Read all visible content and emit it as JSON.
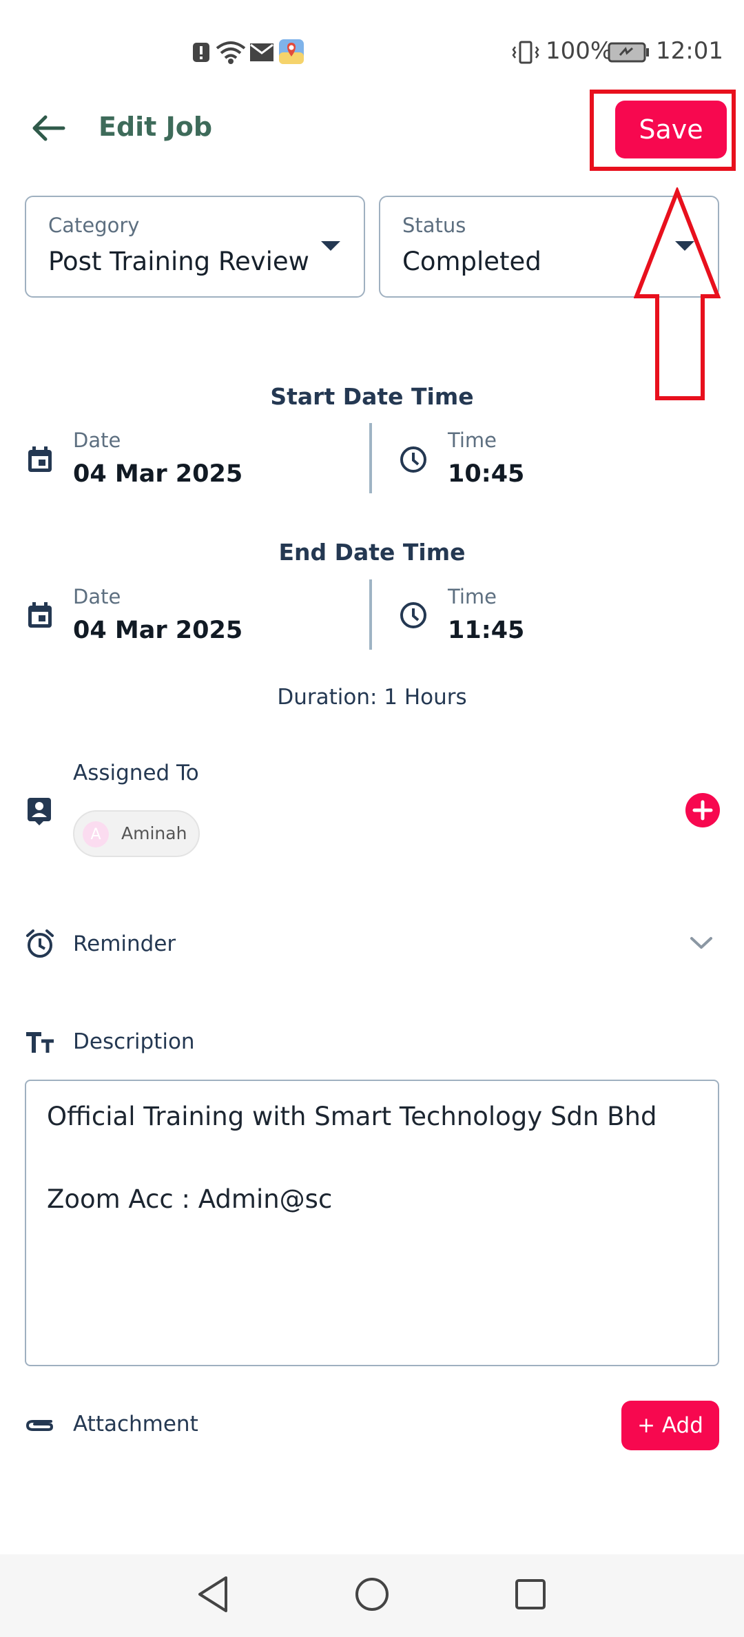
{
  "status_bar": {
    "battery": "100%",
    "time": "12:01"
  },
  "header": {
    "title": "Edit Job",
    "save_label": "Save"
  },
  "category": {
    "label": "Category",
    "value": "Post Training Review"
  },
  "status": {
    "label": "Status",
    "value": "Completed"
  },
  "start": {
    "title": "Start Date Time",
    "date_label": "Date",
    "date": "04 Mar 2025",
    "time_label": "Time",
    "time": "10:45"
  },
  "end": {
    "title": "End Date Time",
    "date_label": "Date",
    "date": "04 Mar 2025",
    "time_label": "Time",
    "time": "11:45"
  },
  "duration": "Duration: 1 Hours",
  "assigned": {
    "label": "Assigned To",
    "chip_initial": "A",
    "chip_name": "Aminah"
  },
  "reminder": {
    "label": "Reminder"
  },
  "description": {
    "label": "Description",
    "value": "Official Training with Smart Technology Sdn Bhd\n\nZoom Acc : Admin@sc"
  },
  "attachment": {
    "label": "Attachment",
    "add_label": "+ Add"
  },
  "colors": {
    "accent": "#f7084f",
    "annotation": "#e8101d",
    "heading": "#243852"
  }
}
